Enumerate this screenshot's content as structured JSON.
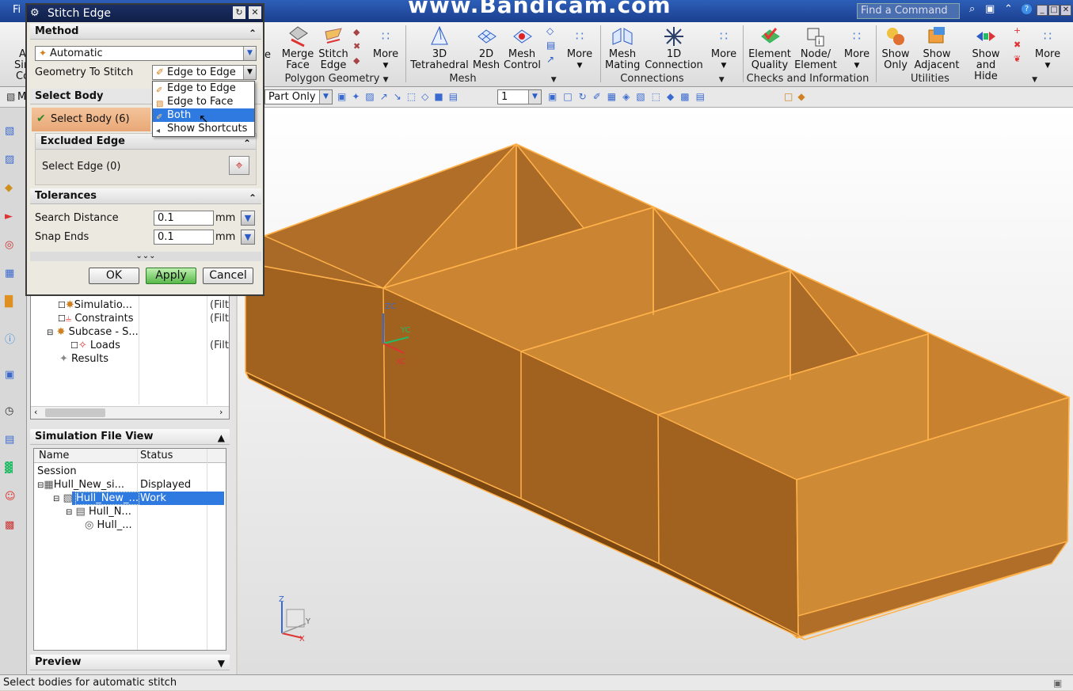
{
  "window": {
    "menu_file": "Fi",
    "watermark": "www.Bandicam.com",
    "find_placeholder": "Find a Command",
    "left_cut_labels": [
      "A",
      "Sim",
      "Co"
    ]
  },
  "ribbon": {
    "polygon_geometry": {
      "label": "Polygon Geometry",
      "buttons": [
        {
          "label1": "Merge",
          "label2": "Face",
          "icon": "merge-face-icon"
        },
        {
          "label1": "Stitch",
          "label2": "Edge",
          "icon": "stitch-edge-icon"
        }
      ],
      "more": "More",
      "partial": "e"
    },
    "mesh": {
      "label": "Mesh",
      "buttons": [
        {
          "label1": "3D",
          "label2": "Tetrahedral",
          "icon": "tetrahedral-icon"
        },
        {
          "label1": "2D",
          "label2": "Mesh",
          "icon": "2d-mesh-icon"
        },
        {
          "label1": "Mesh",
          "label2": "Control",
          "icon": "mesh-control-icon"
        }
      ],
      "more": "More"
    },
    "connections": {
      "label": "Connections",
      "buttons": [
        {
          "label1": "Mesh",
          "label2": "Mating",
          "icon": "mesh-mating-icon"
        },
        {
          "label1": "1D",
          "label2": "Connection",
          "icon": "1d-connection-icon"
        }
      ],
      "more": "More"
    },
    "checks": {
      "label": "Checks and Information",
      "buttons": [
        {
          "label1": "Element",
          "label2": "Quality",
          "icon": "element-quality-icon"
        },
        {
          "label1": "Node/",
          "label2": "Element",
          "icon": "node-element-icon"
        }
      ],
      "more": "More"
    },
    "utilities": {
      "label": "Utilities",
      "buttons": [
        {
          "label1": "Show",
          "label2": "Only",
          "icon": "show-only-icon"
        },
        {
          "label1": "Show",
          "label2": "Adjacent",
          "icon": "show-adjacent-icon"
        },
        {
          "label1": "Show",
          "label2": "and Hide",
          "icon": "show-and-hide-icon"
        }
      ],
      "more": "More"
    }
  },
  "toolbar2": {
    "filter_value": "Part Only",
    "layer_value": "1",
    "partial_label": "M"
  },
  "dialog": {
    "title": "Stitch Edge",
    "method": {
      "header": "Method",
      "type_value": "Automatic",
      "geometry_label": "Geometry To Stitch",
      "geometry_value": "Edge to Edge"
    },
    "dropdown_options": [
      "Edge to Edge",
      "Edge to Face",
      "Both",
      "Show Shortcuts"
    ],
    "dropdown_selected": "Both",
    "select_body": {
      "header": "Select Body",
      "label": "Select Body (6)"
    },
    "excluded_edge": {
      "header": "Excluded Edge",
      "label": "Select Edge (0)"
    },
    "tolerances": {
      "header": "Tolerances",
      "search_label": "Search Distance",
      "search_value": "0.1",
      "snap_label": "Snap Ends",
      "snap_value": "0.1",
      "unit": "mm"
    },
    "ok": "OK",
    "apply": "Apply",
    "cancel": "Cancel"
  },
  "nav_tree": {
    "rows": [
      {
        "label": "Simulatio...",
        "col2": "(Filt"
      },
      {
        "label": "Constraints",
        "col2": "(Filt"
      },
      {
        "label": "Subcase - S...",
        "col2": ""
      },
      {
        "label": "Loads",
        "col2": "(Filt"
      },
      {
        "label": "Results",
        "col2": ""
      }
    ]
  },
  "sim_file_view": {
    "title": "Simulation File View",
    "col_name": "Name",
    "col_status": "Status",
    "rows": [
      {
        "name": "Session",
        "status": ""
      },
      {
        "name": "Hull_New_si...",
        "status": "Displayed"
      },
      {
        "name": "Hull_New_...",
        "status": "Work"
      },
      {
        "name": "Hull_N...",
        "status": ""
      },
      {
        "name": "Hull_...",
        "status": ""
      }
    ],
    "preview": "Preview"
  },
  "viewport": {
    "axis_zc": "ZC",
    "axis_yc": "YC",
    "axis_xc": "XC",
    "triad_z": "Z",
    "triad_y": "Y",
    "triad_x": "X",
    "model_color": "#c8812f",
    "edge_color": "#ffb14a"
  },
  "status_bar": {
    "text": "Select bodies for automatic stitch"
  }
}
